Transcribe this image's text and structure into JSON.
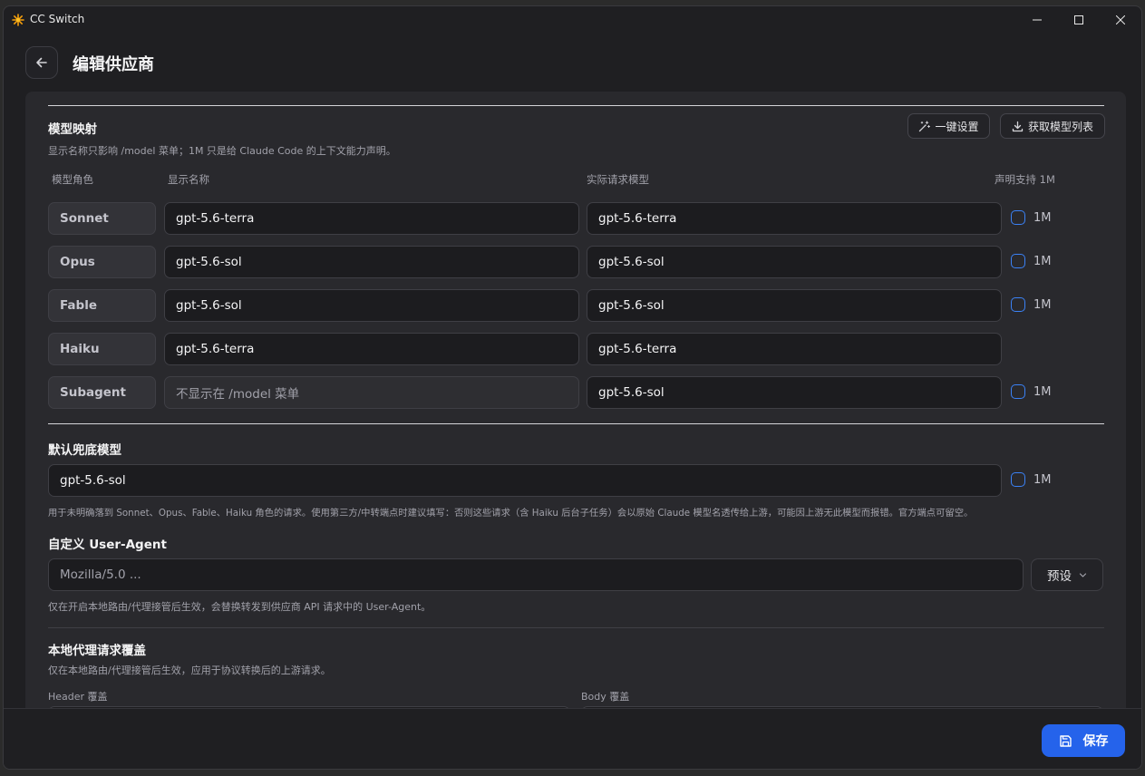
{
  "window": {
    "title": "CC Switch"
  },
  "header": {
    "title": "编辑供应商"
  },
  "model_mapping": {
    "title": "模型映射",
    "hint": "显示名称只影响 /model 菜单；1M 只是给 Claude Code 的上下文能力声明。",
    "one_click_label": "一键设置",
    "fetch_label": "获取模型列表",
    "columns": {
      "role": "模型角色",
      "display": "显示名称",
      "actual": "实际请求模型",
      "support": "声明支持 1M"
    },
    "rows": [
      {
        "role": "Sonnet",
        "display": "gpt-5.6-terra",
        "actual": "gpt-5.6-terra",
        "flag": "1M"
      },
      {
        "role": "Opus",
        "display": "gpt-5.6-sol",
        "actual": "gpt-5.6-sol",
        "flag": "1M"
      },
      {
        "role": "Fable",
        "display": "gpt-5.6-sol",
        "actual": "gpt-5.6-sol",
        "flag": "1M"
      },
      {
        "role": "Haiku",
        "display": "gpt-5.6-terra",
        "actual": "gpt-5.6-terra"
      },
      {
        "role": "Subagent",
        "display_placeholder": "不显示在 /model 菜单",
        "actual": "gpt-5.6-sol",
        "flag": "1M"
      }
    ]
  },
  "default_model": {
    "title": "默认兜底模型",
    "value": "gpt-5.6-sol",
    "flag": "1M",
    "hint": "用于未明确落到 Sonnet、Opus、Fable、Haiku 角色的请求。使用第三方/中转端点时建议填写：否则这些请求（含 Haiku 后台子任务）会以原始 Claude 模型名透传给上游，可能因上游无此模型而报错。官方端点可留空。"
  },
  "user_agent": {
    "title": "自定义 User-Agent",
    "placeholder": "Mozilla/5.0 ...",
    "preset_label": "预设",
    "hint": "仅在开启本地路由/代理接管后生效，会替换转发到供应商 API 请求中的 User-Agent。"
  },
  "proxy_override": {
    "title": "本地代理请求覆盖",
    "hint": "仅在本地路由/代理接管后生效，应用于协议转换后的上游请求。",
    "header_label": "Header 覆盖",
    "body_label": "Body 覆盖"
  },
  "footer": {
    "save_label": "保存"
  },
  "colors": {
    "accent": "#2563eb",
    "checkbox": "#3b82f6"
  }
}
